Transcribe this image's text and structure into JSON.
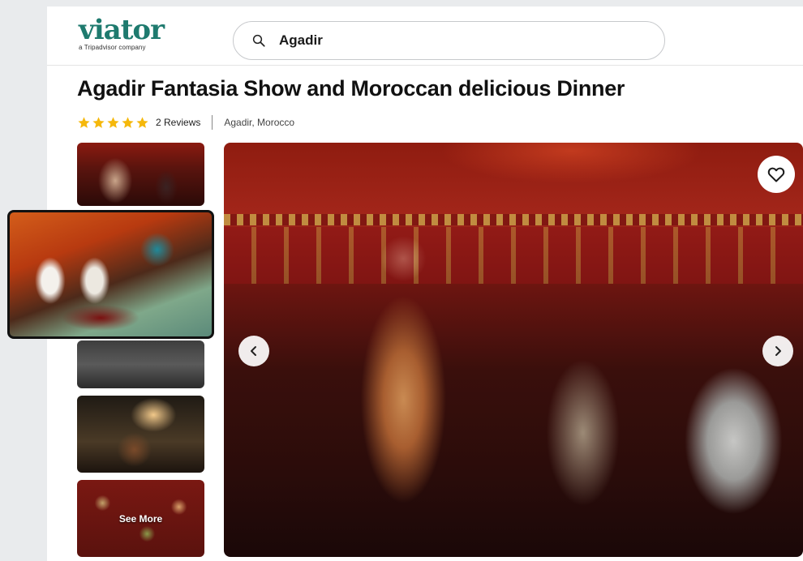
{
  "brand": {
    "name": "viator",
    "tagline": "a Tripadvisor company",
    "color": "#1e7a6e"
  },
  "search": {
    "value": "Agadir"
  },
  "listing": {
    "title": "Agadir Fantasia Show and Moroccan delicious Dinner",
    "rating": 5,
    "reviews": "2 Reviews",
    "location": "Agadir, Morocco"
  },
  "gallery": {
    "see_more": "See More"
  },
  "icons": {
    "search": "search-icon",
    "favorite": "heart-icon",
    "prev": "chevron-left-icon",
    "next": "chevron-right-icon",
    "star": "star-icon"
  },
  "colors": {
    "star": "#f5b80b"
  }
}
